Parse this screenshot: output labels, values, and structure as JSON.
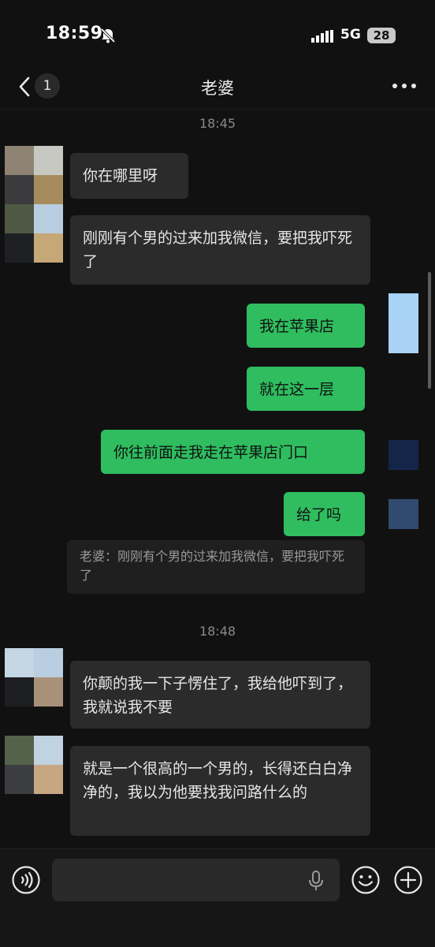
{
  "status_bar": {
    "time": "18:59",
    "network": "5G",
    "battery": "28"
  },
  "header": {
    "unread_count": "1",
    "title": "老婆"
  },
  "timestamps": [
    "18:45",
    "18:48"
  ],
  "messages": [
    {
      "side": "in",
      "text": "你在哪里呀"
    },
    {
      "side": "in",
      "text": "刚刚有个男的过来加我微信，要把我吓死了"
    },
    {
      "side": "out",
      "text": "我在苹果店"
    },
    {
      "side": "out",
      "text": "就在这一层"
    },
    {
      "side": "out",
      "text": "你往前面走我走在苹果店门口"
    },
    {
      "side": "out",
      "text": "给了吗"
    },
    {
      "side": "in",
      "text": "你颠的我一下子愣住了，我给他吓到了，我就说我不要"
    },
    {
      "side": "in",
      "text": "就是一个很高的一个男的，长得还白白净净的，我以为他要找我问路什么的"
    }
  ],
  "quote": {
    "text": "老婆：刚刚有个男的过来加我微信，要把我吓死了"
  },
  "input_bar": {
    "placeholder": "",
    "icons": [
      "voice-icon",
      "mic-icon",
      "emoji-icon",
      "plus-icon"
    ]
  },
  "colors": {
    "background": "#111111",
    "incoming_bubble": "#2b2b2b",
    "outgoing_bubble": "#2fbd5f",
    "timestamp": "#8a8a8a"
  }
}
